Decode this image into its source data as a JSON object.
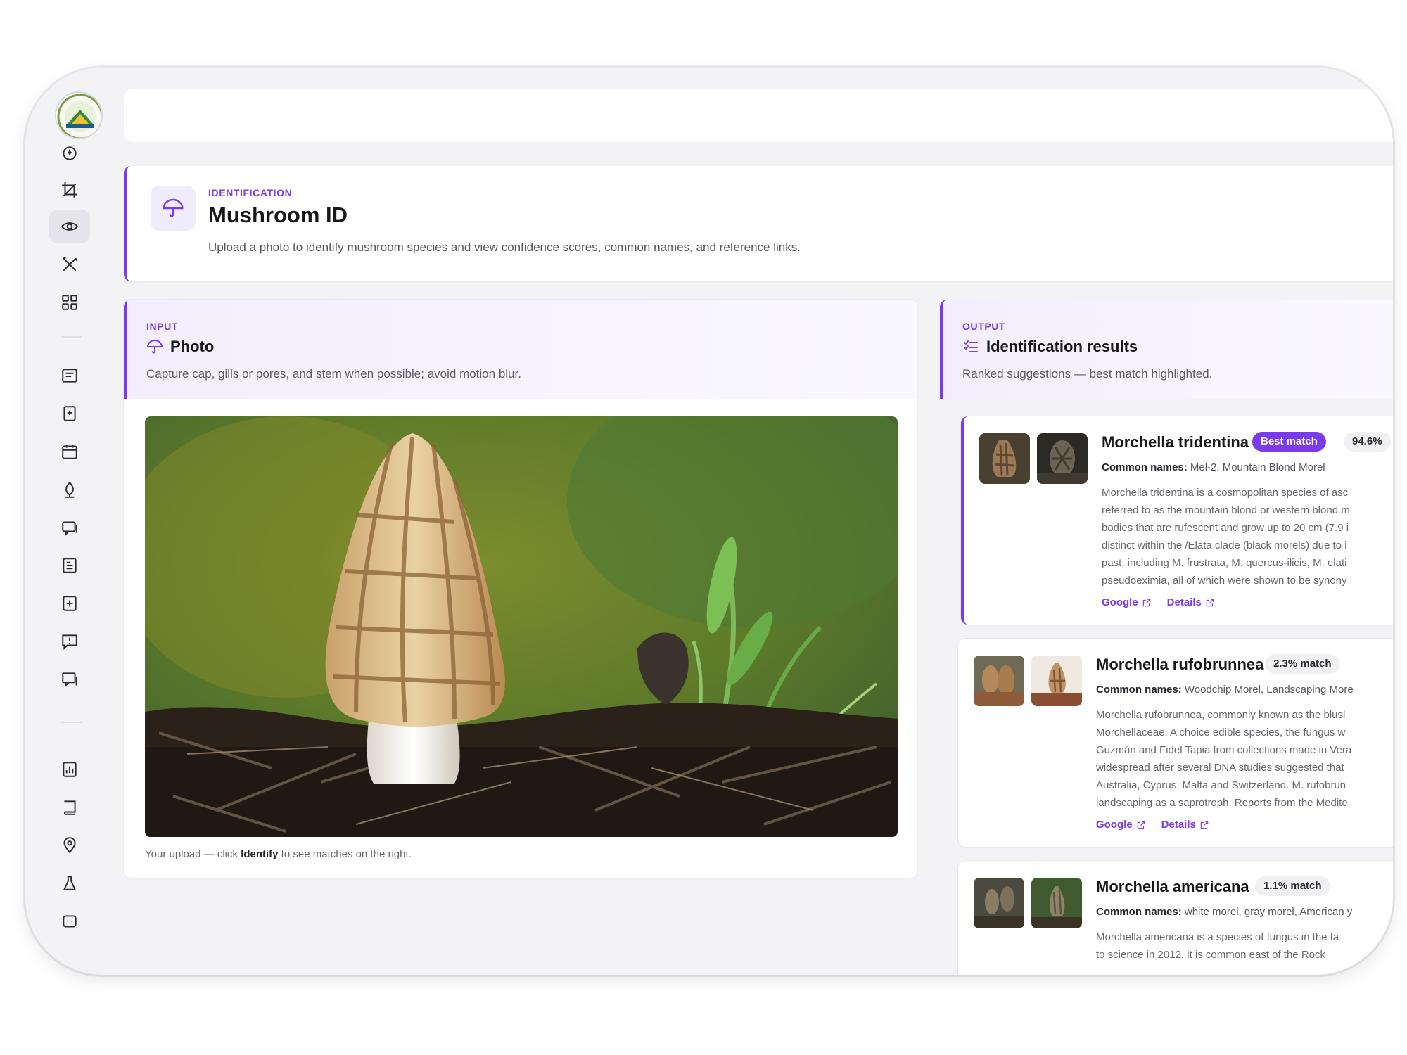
{
  "header": {
    "eyebrow": "IDENTIFICATION",
    "title": "Mushroom ID",
    "description": "Upload a photo to identify mushroom species and view confidence scores, common names, and reference links."
  },
  "input": {
    "eyebrow": "INPUT",
    "title": "Photo",
    "description": "Capture cap, gills or pores, and stem when possible; avoid motion blur.",
    "caption_pre": "Your upload — click ",
    "caption_bold": "Identify",
    "caption_post": " to see matches on the right."
  },
  "output": {
    "eyebrow": "OUTPUT",
    "title": "Identification results",
    "description": "Ranked suggestions — best match highlighted.",
    "common_label": "Common names:",
    "results": [
      {
        "name": "Morchella tridentina",
        "badge": "Best match",
        "score": "94.6%",
        "common_names": "Mel-2, Mountain Blond Morel",
        "description_lines": [
          "Morchella tridentina is a cosmopolitan species of asc",
          "referred to as the mountain blond or western blond m",
          "bodies that are rufescent and grow up to 20 cm (7.9 i",
          "distinct within the /Elata clade (black morels) due to i",
          "past, including M. frustrata, M. quercus-ilicis, M. elati",
          "pseudoeximia, all of which were shown to be synony"
        ],
        "link_google": "Google",
        "link_details": "Details"
      },
      {
        "name": "Morchella rufobrunnea",
        "score": "2.3% match",
        "common_names": "Woodchip Morel, Landscaping More",
        "description_lines": [
          "Morchella rufobrunnea, commonly known as the blusl",
          "Morchellaceae. A choice edible species, the fungus w",
          "Guzmán and Fidel Tapia from collections made in Vera",
          "widespread after several DNA studies suggested that",
          "Australia, Cyprus, Malta and Switzerland. M. rufobrun",
          "landscaping as a saprotroph. Reports from the Medite"
        ],
        "link_google": "Google",
        "link_details": "Details"
      },
      {
        "name": "Morchella americana",
        "score": "1.1% match",
        "common_names": "white morel, gray morel, American y",
        "description_lines": [
          "Morchella americana is a species of fungus in the fa",
          "to science in 2012, it is common east of the Rock"
        ]
      }
    ]
  },
  "sidebar": {
    "icons": [
      "power-icon",
      "crop-icon",
      "eye-icon",
      "tools-icon",
      "apps-grid-icon",
      "news-icon",
      "document-icon",
      "calendar-icon",
      "sprout-icon",
      "messages-icon",
      "report-icon",
      "add-file-icon",
      "alert-message-icon",
      "chat-icon",
      "chart-icon",
      "book-icon",
      "location-pin-icon",
      "flask-icon",
      "message-box-icon"
    ],
    "active": "eye-icon"
  },
  "colors": {
    "accent": "#7c3aed",
    "accent_soft": "#f1ecfd",
    "frame": "#f3f3f5"
  }
}
